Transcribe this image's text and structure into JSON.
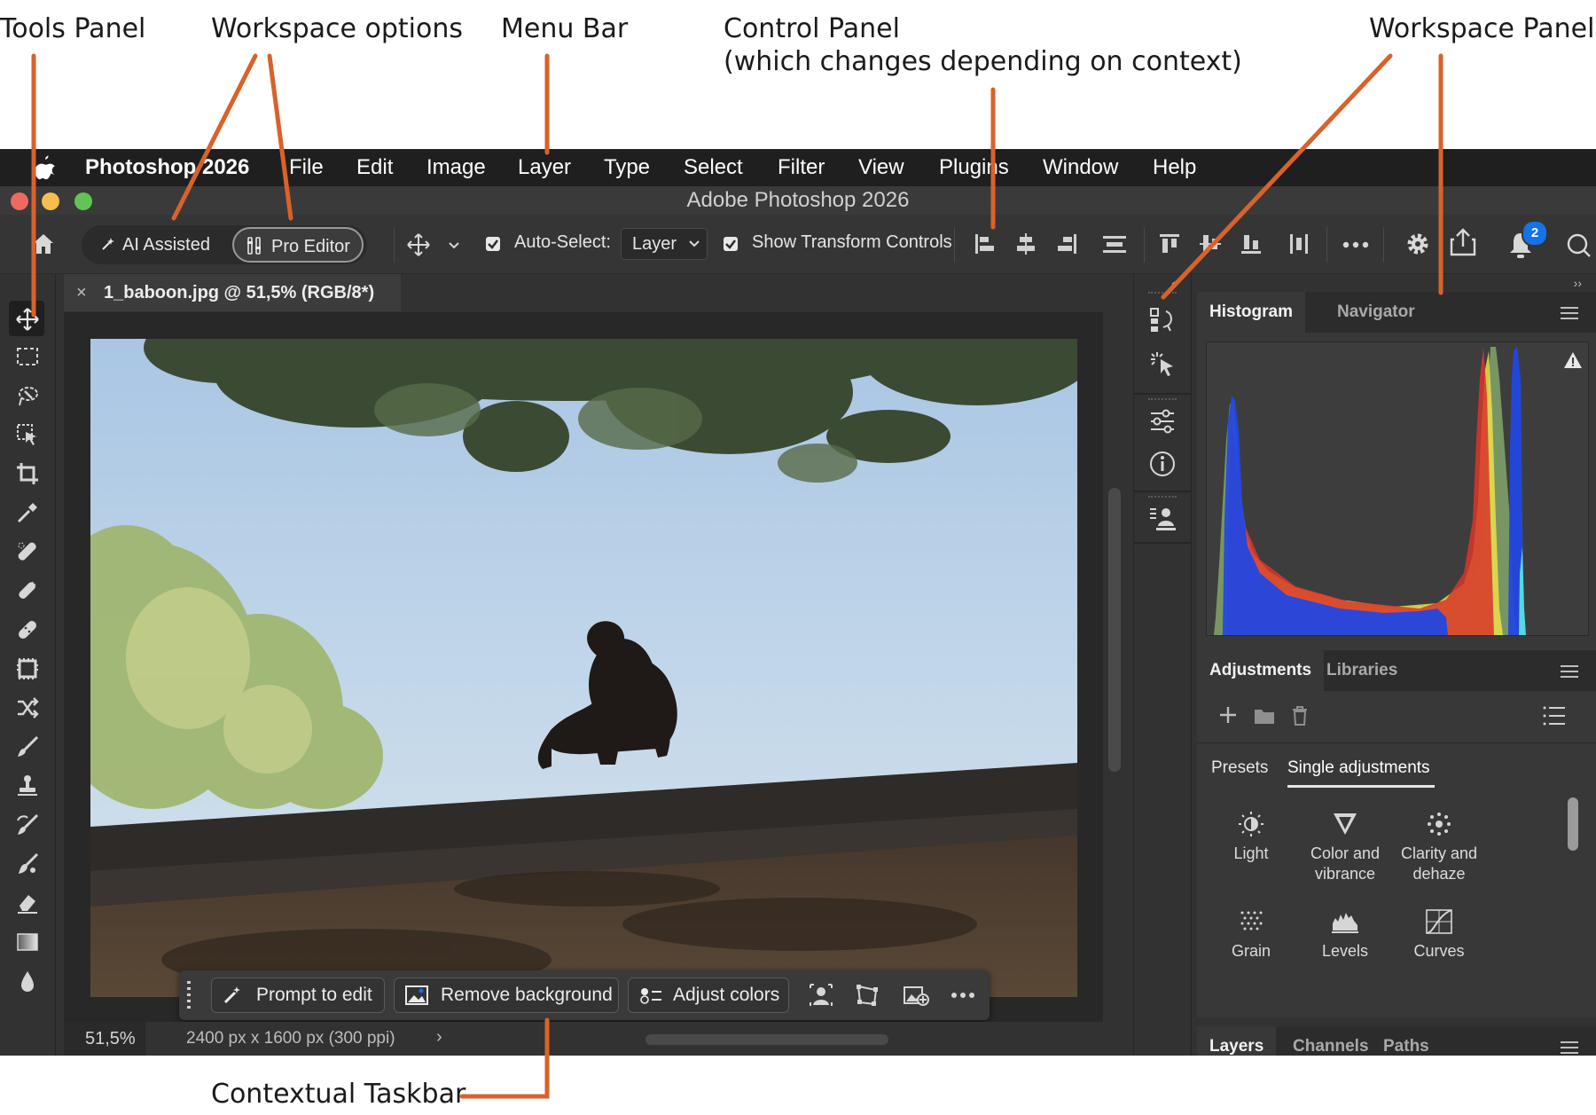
{
  "annotations": {
    "tools_panel": "Tools Panel",
    "workspace_options": "Workspace options",
    "menu_bar": "Menu Bar",
    "control_panel_line1": "Control Panel",
    "control_panel_line2": "(which changes depending on context)",
    "workspace_panels": "Workspace Panels",
    "contextual_taskbar": "Contextual Taskbar",
    "line_color": "#d9622b"
  },
  "menubar": {
    "app_name": "Photoshop 2026",
    "items": [
      "File",
      "Edit",
      "Image",
      "Layer",
      "Type",
      "Select",
      "Filter",
      "View",
      "Plugins",
      "Window",
      "Help"
    ]
  },
  "window": {
    "title": "Adobe Photoshop 2026",
    "traffic_lights": [
      "#ed6a5e",
      "#f5bf4f",
      "#61c554"
    ]
  },
  "options_bar": {
    "workspace_ai": "AI Assisted",
    "workspace_pro": "Pro Editor",
    "auto_select_label": "Auto-Select:",
    "auto_select_checked": true,
    "auto_select_value": "Layer",
    "show_transform_label": "Show Transform Controls",
    "show_transform_checked": true,
    "notification_count": "2",
    "accent": "#1473e6"
  },
  "document": {
    "tab_title": "1_baboon.jpg @ 51,5% (RGB/8*)",
    "zoom": "51,5%",
    "doc_info": "2400 px x 1600 px (300 ppi)"
  },
  "tools": [
    "move-tool",
    "marquee-tool",
    "lasso-tool",
    "object-selection-tool",
    "crop-tool",
    "eyedropper-tool",
    "spot-healing-tool",
    "remove-tool",
    "healing-brush-tool",
    "patch-tool",
    "content-aware-move-tool",
    "brush-tool",
    "clone-stamp-tool",
    "history-brush-tool",
    "mixer-brush-tool",
    "eraser-tool",
    "gradient-tool",
    "blur-tool"
  ],
  "taskbar": {
    "prompt": "Prompt to edit",
    "remove_bg": "Remove background",
    "adjust": "Adjust colors"
  },
  "panels": {
    "top_tabs": [
      "Histogram",
      "Navigator"
    ],
    "mid_tabs": [
      "Adjustments",
      "Libraries"
    ],
    "sub_tabs": [
      "Presets",
      "Single adjustments"
    ],
    "adjustments": [
      {
        "line1": "Light",
        "line2": ""
      },
      {
        "line1": "Color and",
        "line2": "vibrance"
      },
      {
        "line1": "Clarity and",
        "line2": "dehaze"
      },
      {
        "line1": "Grain",
        "line2": ""
      },
      {
        "line1": "Levels",
        "line2": ""
      },
      {
        "line1": "Curves",
        "line2": ""
      }
    ],
    "bottom_tabs": [
      "Layers",
      "Channels",
      "Paths"
    ]
  }
}
